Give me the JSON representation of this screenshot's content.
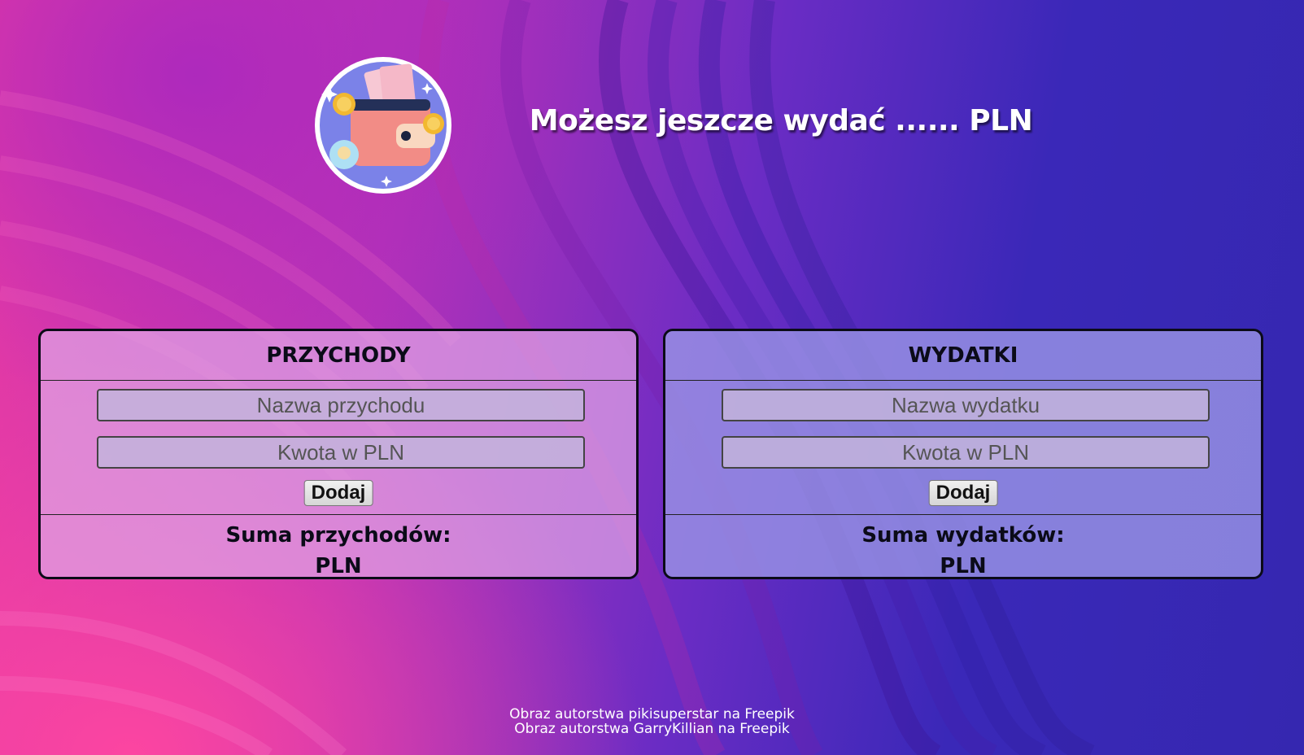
{
  "header": {
    "headline": "Możesz jeszcze wydać ...... PLN",
    "logo_icon": "wallet-icon"
  },
  "income_panel": {
    "title": "PRZYCHODY",
    "name_placeholder": "Nazwa przychodu",
    "amount_placeholder": "Kwota w PLN",
    "add_label": "Dodaj",
    "sum_label": "Suma przychodów:",
    "sum_value": "PLN",
    "background": "#e1a5e6"
  },
  "expense_panel": {
    "title": "WYDATKI",
    "name_placeholder": "Nazwa wydatku",
    "amount_placeholder": "Kwota w PLN",
    "add_label": "Dodaj",
    "sum_label": "Suma wydatków:",
    "sum_value": "PLN",
    "background": "#9b96e6"
  },
  "footer": {
    "credit_1": "Obraz autorstwa pikisuperstar na Freepik",
    "credit_2": "Obraz autorstwa GarryKillian na Freepik"
  },
  "colors": {
    "background_pink": "#ff46a0",
    "background_purple": "#b432b8",
    "background_blue": "#3527b0",
    "text_white": "#ffffff",
    "text_dark": "#0b0b18"
  }
}
